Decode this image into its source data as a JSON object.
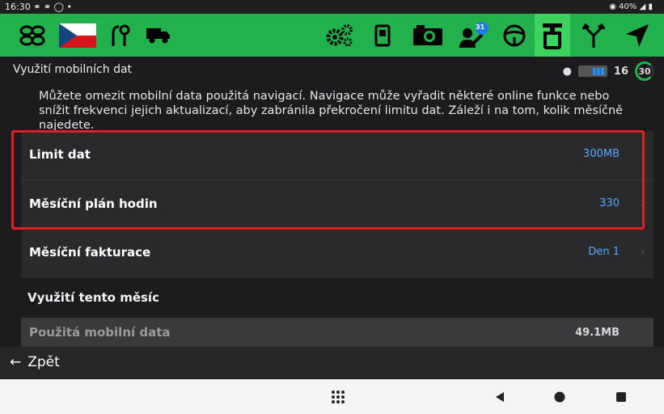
{
  "status_bar": {
    "time": "16:30",
    "left_icons": [
      "link-icon",
      "link-icon",
      "shield-icon",
      "dot-icon"
    ],
    "right_text": "40%",
    "right_icons": [
      "location-icon",
      "signal-icon",
      "battery-icon"
    ]
  },
  "toolbar": {
    "left_items": [
      "network-icon",
      "czech-flag-icon",
      "route-settings-icon",
      "truck-icon"
    ],
    "right_items": [
      "gears-icon",
      "fuel-icon",
      "camera-icon",
      "notifications-icon",
      "steering-wheel-icon",
      "road-sign-icon",
      "fork-icon",
      "navigate-icon"
    ],
    "notification_badge": "31",
    "active_item": "road-sign-icon",
    "color": "#22b14c"
  },
  "header": {
    "title": "Využití mobilních dat",
    "counter": "16",
    "ring_value": "30"
  },
  "description": "Můžete omezit mobilní data použitá navigací. Navigace může vyřadit některé online funkce nebo snížit frekvenci jejich aktualizací, aby zabránila překročení limitu dat. Záleží i na tom, kolik měsíčně najedete.",
  "settings": [
    {
      "label": "Limit dat",
      "value": "300MB"
    },
    {
      "label": "Měsíční plán hodin",
      "value": "330"
    },
    {
      "label": "Měsíční fakturace",
      "value": "Den 1"
    }
  ],
  "usage": {
    "section_title": "Využití tento měsíc",
    "label": "Použitá mobilní data",
    "value": "49.1MB"
  },
  "back": {
    "label": "Zpět"
  },
  "android_nav": [
    "apps-grid-icon",
    "back-icon",
    "home-icon",
    "recents-icon"
  ],
  "highlight_color": "#e02020",
  "value_color": "#5aa9ff"
}
